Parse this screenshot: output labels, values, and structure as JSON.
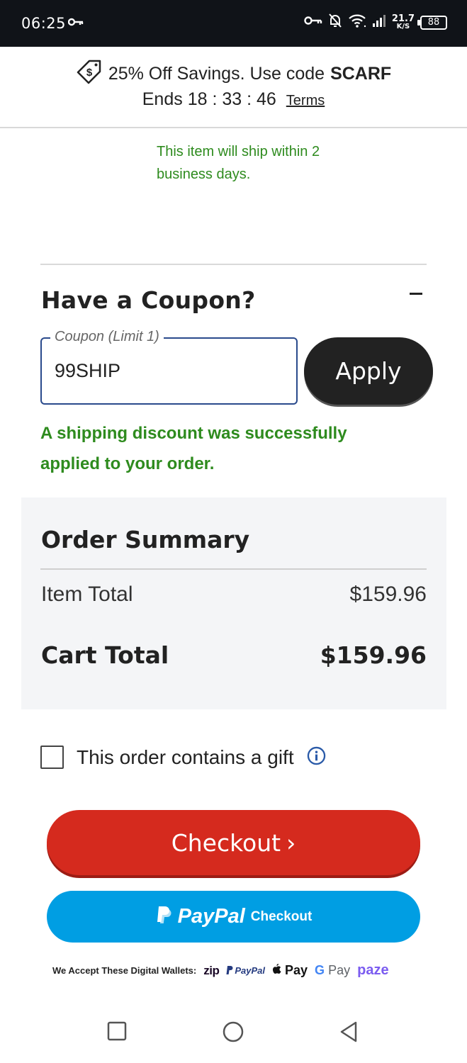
{
  "status_bar": {
    "time": "06:25",
    "speed_value": "21.7",
    "speed_unit": "K/S",
    "battery": "88",
    "icons": [
      "key-icon",
      "vpn-key-icon",
      "bell-off-icon",
      "wifi-icon",
      "signal-icon",
      "battery-icon"
    ]
  },
  "promo": {
    "text": "25% Off Savings. Use code",
    "code": "SCARF",
    "ends_label": "Ends",
    "timer": "18 : 33 : 46",
    "terms_label": "Terms",
    "icon": "price-tag-icon"
  },
  "shipping_note": "This item will ship within 2 business days.",
  "coupon": {
    "title": "Have a Coupon?",
    "field_label": "Coupon (Limit 1)",
    "field_value": "99SHIP",
    "apply_label": "Apply",
    "success_message": "A shipping discount was successfully applied to your order."
  },
  "order_summary": {
    "title": "Order Summary",
    "item_total_label": "Item Total",
    "item_total_value": "$159.96",
    "cart_total_label": "Cart Total",
    "cart_total_value": "$159.96"
  },
  "gift": {
    "label": "This order contains a gift",
    "checked": false
  },
  "checkout": {
    "label": "Checkout",
    "chevron": "›"
  },
  "paypal": {
    "brand": "PayPal",
    "label": "Checkout"
  },
  "wallets": {
    "label": "We Accept These Digital Wallets:",
    "items": [
      "zip",
      "PayPal",
      "Pay",
      "Pay",
      "paze"
    ]
  },
  "colors": {
    "status_bar_bg": "#101318",
    "success_green": "#2e8b1e",
    "checkout_red": "#d52a1e",
    "paypal_blue": "#009ee3",
    "apply_dark": "#222222",
    "summary_bg": "#f4f5f7",
    "field_border": "#2a4a8c"
  }
}
